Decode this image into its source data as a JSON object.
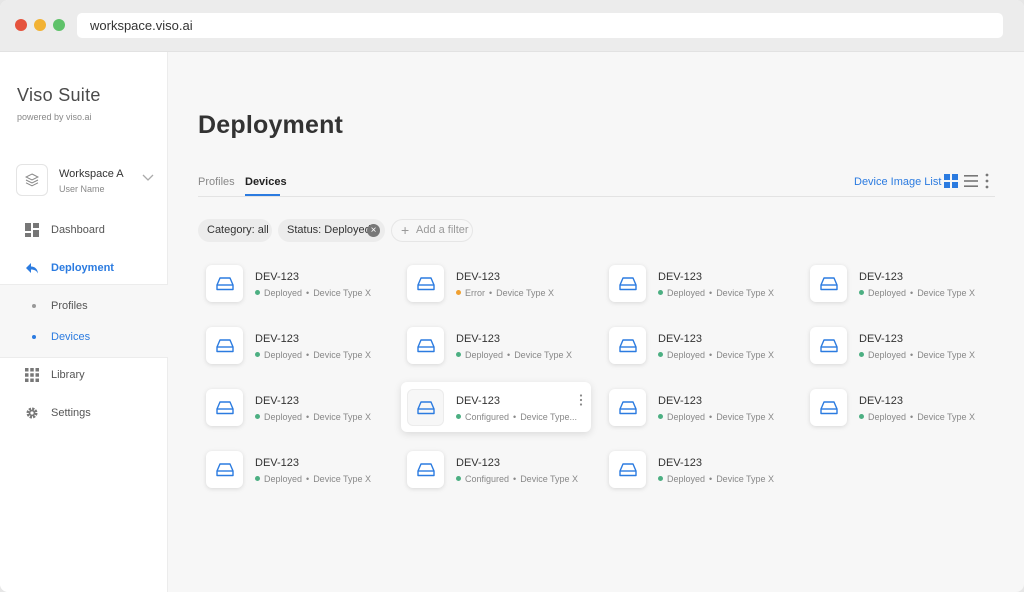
{
  "browser": {
    "url": "workspace.viso.ai"
  },
  "sidebar": {
    "brand": "Viso Suite",
    "powered_by": "powered by viso.ai",
    "workspace": {
      "name": "Workspace A",
      "user": "User Name"
    },
    "nav": [
      {
        "label": "Dashboard",
        "icon": "dashboard-icon"
      },
      {
        "label": "Deployment",
        "icon": "deployment-icon",
        "active": true
      },
      {
        "label": "Library",
        "icon": "library-icon"
      },
      {
        "label": "Settings",
        "icon": "gear-icon"
      }
    ],
    "subnav": [
      {
        "label": "Profiles"
      },
      {
        "label": "Devices",
        "active": true
      }
    ]
  },
  "main": {
    "title": "Deployment",
    "tabs": [
      {
        "label": "Profiles"
      },
      {
        "label": "Devices",
        "active": true
      }
    ],
    "device_image_list": "Device Image List",
    "filters": [
      {
        "label": "Category: all"
      },
      {
        "label": "Status: Deployed"
      }
    ],
    "add_filter": "Add a filter",
    "devices": [
      {
        "name": "DEV-123",
        "status": "Deployed",
        "type": "Device Type X"
      },
      {
        "name": "DEV-123",
        "status": "Error",
        "type": "Device Type X"
      },
      {
        "name": "DEV-123",
        "status": "Deployed",
        "type": "Device Type X"
      },
      {
        "name": "DEV-123",
        "status": "Deployed",
        "type": "Device Type X"
      },
      {
        "name": "DEV-123",
        "status": "Deployed",
        "type": "Device Type X"
      },
      {
        "name": "DEV-123",
        "status": "Deployed",
        "type": "Device Type X"
      },
      {
        "name": "DEV-123",
        "status": "Deployed",
        "type": "Device Type X"
      },
      {
        "name": "DEV-123",
        "status": "Deployed",
        "type": "Device Type X"
      },
      {
        "name": "DEV-123",
        "status": "Deployed",
        "type": "Device Type X"
      },
      {
        "name": "DEV-123",
        "status": "Configured",
        "type": "Device Type..."
      },
      {
        "name": "DEV-123",
        "status": "Deployed",
        "type": "Device Type X"
      },
      {
        "name": "DEV-123",
        "status": "Deployed",
        "type": "Device Type X"
      },
      {
        "name": "DEV-123",
        "status": "Deployed",
        "type": "Device Type X"
      },
      {
        "name": "DEV-123",
        "status": "Configured",
        "type": "Device Type X"
      },
      {
        "name": "DEV-123",
        "status": "Deployed",
        "type": "Device Type X"
      }
    ]
  },
  "colors": {
    "accent": "#2b7be0",
    "deployed": "#4caf82",
    "error": "#f0a030",
    "configured": "#4caf82"
  }
}
